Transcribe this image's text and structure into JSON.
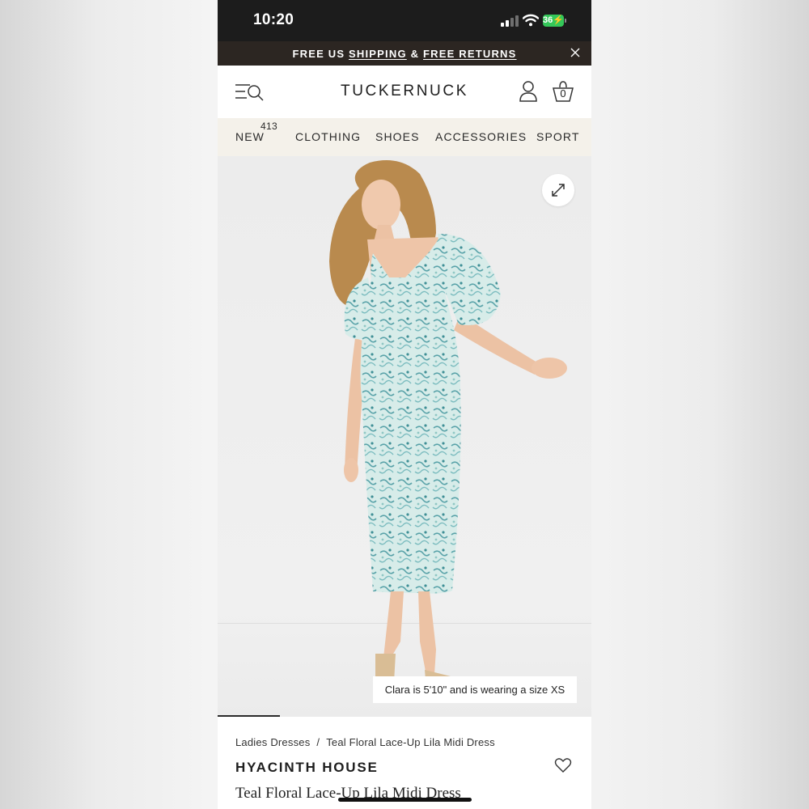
{
  "status_bar": {
    "time": "10:20",
    "battery": "36"
  },
  "promo": {
    "prefix": "FREE US",
    "shipping": "SHIPPING",
    "amp": "&",
    "returns": "FREE RETURNS"
  },
  "header": {
    "logo": "TUCKERNUCK",
    "bag_count": "0"
  },
  "nav": {
    "items": [
      "NEW",
      "CLOTHING",
      "SHOES",
      "ACCESSORIES",
      "SPORT"
    ],
    "new_badge": "413"
  },
  "product_image": {
    "caption": "Clara is 5'10\" and is wearing a size XS",
    "dress_colors": {
      "base": "#d7ece9",
      "print": "#5aa3a9"
    }
  },
  "product": {
    "breadcrumb": [
      "Ladies Dresses",
      "Teal Floral Lace-Up Lila Midi Dress"
    ],
    "breadcrumb_sep": "/",
    "brand": "HYACINTH HOUSE",
    "title": "Teal Floral Lace-Up Lila Midi Dress"
  }
}
